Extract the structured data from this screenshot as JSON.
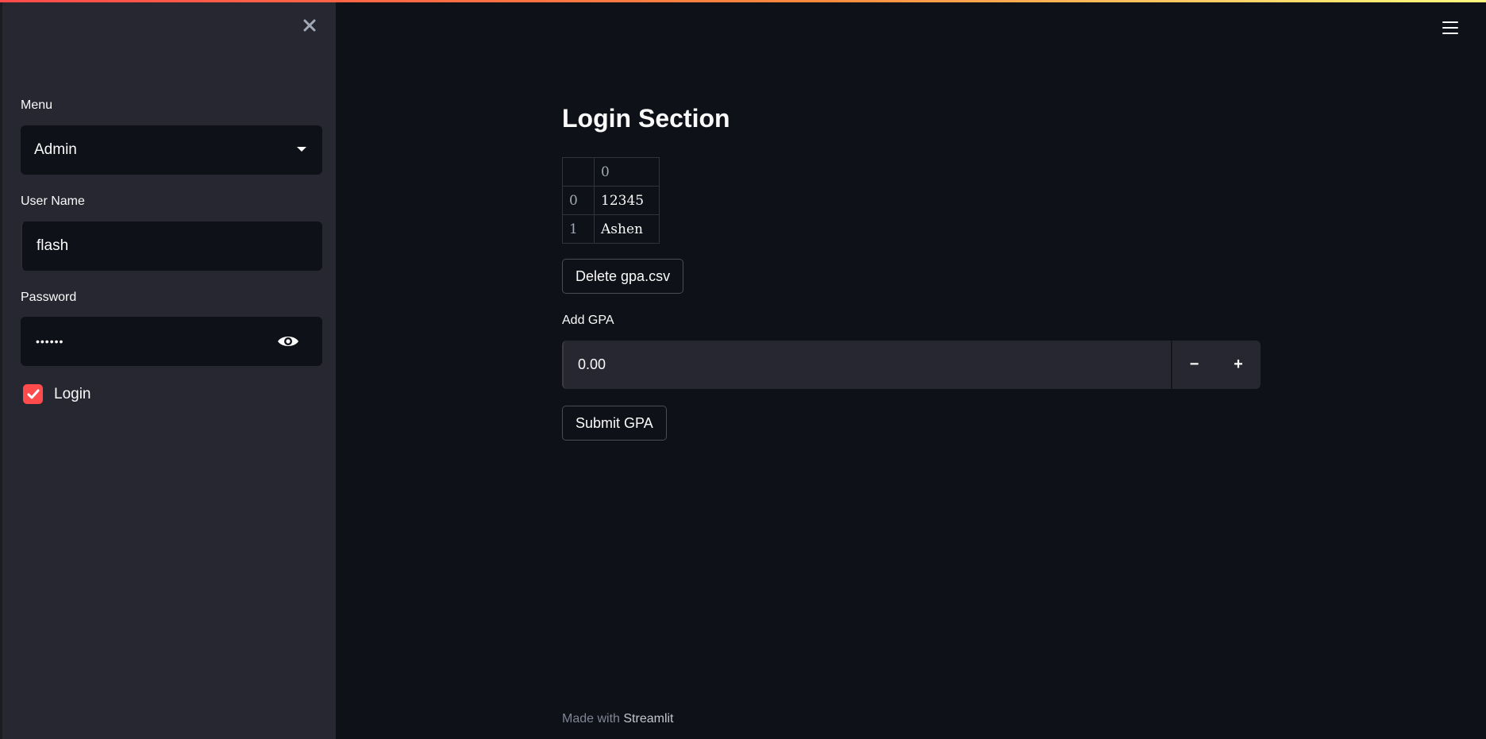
{
  "colors": {
    "background": "#0e1117",
    "sidebar": "#262730",
    "accent": "#ff4b4b",
    "text": "#fafafa"
  },
  "sidebar": {
    "close_icon": "close-icon",
    "menu_label": "Menu",
    "menu_selected": "Admin",
    "username_label": "User Name",
    "username_value": "flash",
    "password_label": "Password",
    "password_display": "••••••",
    "password_icon": "eye-icon",
    "login_checkbox_label": "Login",
    "login_checked": true
  },
  "header": {
    "menu_icon": "hamburger-icon"
  },
  "main": {
    "title": "Login Section",
    "table": {
      "columns": [
        "",
        "0"
      ],
      "rows": [
        {
          "index": "0",
          "value": "12345"
        },
        {
          "index": "1",
          "value": "Ashen"
        }
      ]
    },
    "delete_button": "Delete gpa.csv",
    "gpa_label": "Add GPA",
    "gpa_value": "0.00",
    "minus_label": "−",
    "plus_label": "+",
    "submit_button": "Submit GPA"
  },
  "footer": {
    "prefix": "Made with ",
    "brand": "Streamlit"
  }
}
